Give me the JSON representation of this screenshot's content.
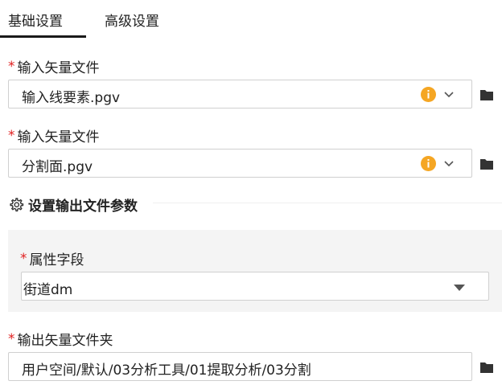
{
  "tabs": [
    {
      "label": "基础设置",
      "active": true
    },
    {
      "label": "高级设置",
      "active": false
    }
  ],
  "required_marker": "*",
  "fields": {
    "input_vector_1": {
      "label": "输入矢量文件",
      "value": "输入线要素.pgv",
      "icons": [
        "info-icon",
        "chevron-down-icon"
      ]
    },
    "input_vector_2": {
      "label": "输入矢量文件",
      "value": "分割面.pgv",
      "icons": [
        "info-icon",
        "chevron-down-icon"
      ]
    }
  },
  "section": {
    "title": "设置输出文件参数",
    "icon": "gear-icon"
  },
  "attribute_field": {
    "label": "属性字段",
    "value": "街道dm",
    "icon": "caret-down-icon"
  },
  "output_folder": {
    "label": "输出矢量文件夹",
    "value": "用户空间/默认/03分析工具/01提取分析/03分割",
    "icon": "folder-icon"
  },
  "colors": {
    "accent_info": "#f5a623",
    "required": "#e02020",
    "tab_indicator": "#1a1a1a",
    "panel_bg": "#f4f4f4",
    "border": "#d0d0d0"
  }
}
